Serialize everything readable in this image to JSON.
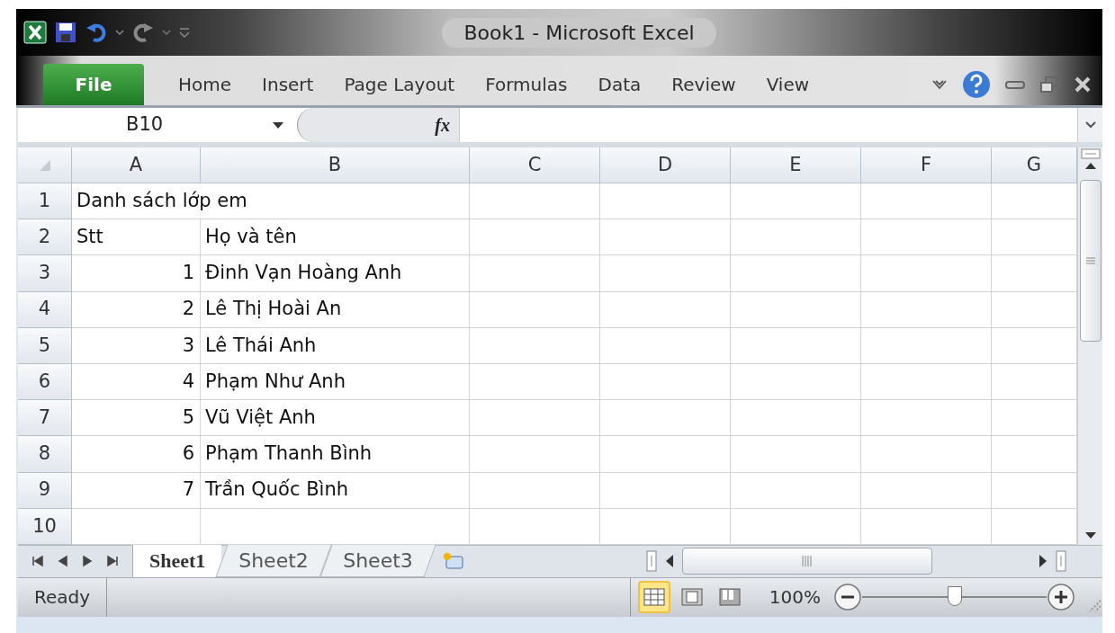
{
  "window": {
    "title": "Book1  -  Microsoft Excel"
  },
  "ribbon_tabs": [
    {
      "label": "File",
      "kind": "file"
    },
    {
      "label": "Home",
      "kind": "tab"
    },
    {
      "label": "Insert",
      "kind": "tab"
    },
    {
      "label": "Page Layout",
      "kind": "tab"
    },
    {
      "label": "Formulas",
      "kind": "tab"
    },
    {
      "label": "Data",
      "kind": "tab"
    },
    {
      "label": "Review",
      "kind": "tab"
    },
    {
      "label": "View",
      "kind": "tab"
    }
  ],
  "name_box": {
    "value": "B10"
  },
  "formula_bar": {
    "function_label": "fx"
  },
  "columns": [
    "A",
    "B",
    "C",
    "D",
    "E",
    "F",
    "G"
  ],
  "rows": [
    {
      "header": "1",
      "a": {
        "text": "Danh sách lớp em",
        "kind": "text"
      }
    },
    {
      "header": "2",
      "a": {
        "text": "Stt",
        "kind": "text"
      },
      "b": {
        "text": "Họ và tên",
        "kind": "text"
      }
    },
    {
      "header": "3",
      "a": {
        "text": "1",
        "kind": "number"
      },
      "b": {
        "text": "Đinh Vạn Hoàng Anh",
        "kind": "text"
      }
    },
    {
      "header": "4",
      "a": {
        "text": "2",
        "kind": "number"
      },
      "b": {
        "text": "Lê Thị Hoài An",
        "kind": "text"
      }
    },
    {
      "header": "5",
      "a": {
        "text": "3",
        "kind": "number"
      },
      "b": {
        "text": "Lê Thái Anh",
        "kind": "text"
      }
    },
    {
      "header": "6",
      "a": {
        "text": "4",
        "kind": "number"
      },
      "b": {
        "text": "Phạm Như Anh",
        "kind": "text"
      }
    },
    {
      "header": "7",
      "a": {
        "text": "5",
        "kind": "number"
      },
      "b": {
        "text": "Vũ Việt Anh",
        "kind": "text"
      }
    },
    {
      "header": "8",
      "a": {
        "text": "6",
        "kind": "number"
      },
      "b": {
        "text": "Phạm Thanh Bình",
        "kind": "text"
      }
    },
    {
      "header": "9",
      "a": {
        "text": "7",
        "kind": "number"
      },
      "b": {
        "text": "Trần Quốc Bình",
        "kind": "text"
      }
    },
    {
      "header": "10"
    }
  ],
  "sheet_tabs": [
    {
      "label": "Sheet1",
      "selected": true
    },
    {
      "label": "Sheet2",
      "selected": false
    },
    {
      "label": "Sheet3",
      "selected": false
    }
  ],
  "status_bar": {
    "status": "Ready",
    "views": [
      {
        "kind": "normal",
        "selected": true
      },
      {
        "kind": "page_layout",
        "selected": false
      },
      {
        "kind": "page_break",
        "selected": false
      }
    ],
    "zoom": "100%",
    "zoom_slider": {
      "level": 0.5
    }
  }
}
